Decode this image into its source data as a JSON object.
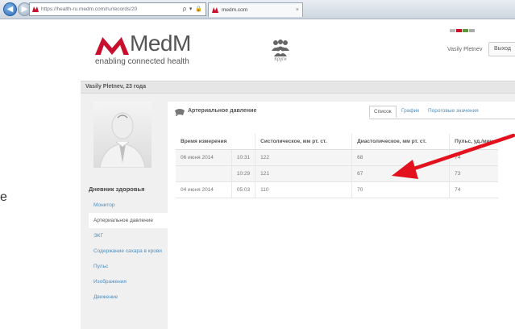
{
  "browser": {
    "url": "https://health-ru.medm.com/ru/records/20",
    "tab_title": "medm.com",
    "address_icons": "ρ ▾ 🔒 ⊠ ¢ ✕"
  },
  "header": {
    "logo_text": "MedM",
    "tagline": "enabling connected health",
    "circles_label": "Круги",
    "username": "Vasily Pletnev",
    "logout_label": "Выход"
  },
  "patient": {
    "name_age": "Vasily Pletnev, 23 года"
  },
  "sidebar": {
    "title": "Дневник здоровья",
    "items": [
      {
        "label": "Монитор",
        "active": false
      },
      {
        "label": "Артериальное давление",
        "active": true
      },
      {
        "label": "ЭКГ",
        "active": false
      },
      {
        "label": "Содержание сахара в крови",
        "active": false
      },
      {
        "label": "Пульс",
        "active": false
      },
      {
        "label": "Изображения",
        "active": false
      },
      {
        "label": "Движение",
        "active": false
      }
    ]
  },
  "main": {
    "section_title": "Артериальное давление",
    "view_tabs": [
      {
        "label": "Список",
        "active": true
      },
      {
        "label": "График",
        "active": false
      },
      {
        "label": "Пороговые значения",
        "active": false
      }
    ],
    "table": {
      "headers": [
        "Время измерения",
        "",
        "Систолическое, мм рт. ст.",
        "Диастолическое, мм рт. ст.",
        "Пульс, уд./мин"
      ],
      "rows": [
        {
          "date": "06 июня 2014",
          "time": "10:31",
          "systolic": "122",
          "diastolic": "68",
          "pulse": "74"
        },
        {
          "date": "",
          "time": "10:29",
          "systolic": "121",
          "diastolic": "67",
          "pulse": "73"
        },
        {
          "date": "04 июня 2014",
          "time": "05:03",
          "systolic": "110",
          "diastolic": "70",
          "pulse": "74"
        }
      ]
    }
  },
  "edge_fragment": "e",
  "annotation": {
    "arrow_color": "#e3101e"
  },
  "colors": {
    "brand": "#c8102e",
    "link": "#4f8fc0"
  }
}
